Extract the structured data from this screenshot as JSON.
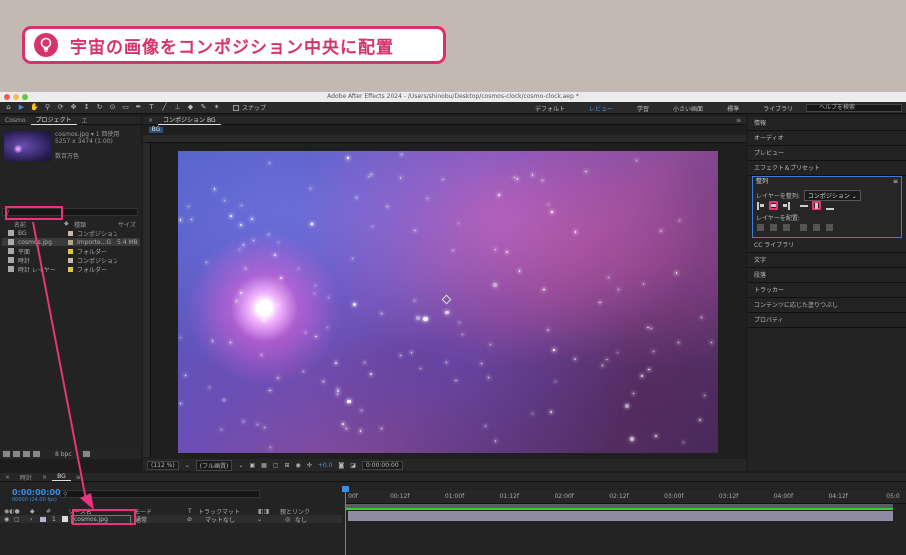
{
  "tip": {
    "title": "宇宙の画像をコンポジション中央に配置"
  },
  "window": {
    "title": "Adobe After Effects 2024 - /Users/shinobu/Desktop/cosmos-clock/cosmo-clock.aep *"
  },
  "toolbar": {
    "snap_label": "スナップ",
    "workspaces": [
      "デフォルト",
      "レビュー",
      "学習",
      "小さい画面",
      "標準",
      "ライブラリ"
    ],
    "active_workspace": "レビュー",
    "help_placeholder": "ヘルプを検索"
  },
  "project": {
    "tabs": [
      "Cosmo",
      "プロジェクト",
      "エ"
    ],
    "meta": [
      "cosmos.jpg ▾ 1 回使用",
      "5257 x 3474 (1.00)",
      "数百万色"
    ],
    "headers": [
      "名前",
      "種類",
      "サイズ"
    ],
    "items": [
      {
        "name": "BG",
        "type": "コンポジション",
        "size": "",
        "color": "#c9bca6"
      },
      {
        "name": "cosmos.jpg",
        "type": "Importe...G",
        "size": "5.4 MB",
        "color": "#b4a58c"
      },
      {
        "name": "平面",
        "type": "フォルダー",
        "size": "",
        "color": "#e0c74a"
      },
      {
        "name": "時計",
        "type": "コンポジション",
        "size": "",
        "color": "#c9bca6"
      },
      {
        "name": "時計 レイヤー",
        "type": "フォルダー",
        "size": "",
        "color": "#e0c74a"
      }
    ],
    "footer_bpc": "8 bpc"
  },
  "comp": {
    "tab": "コンポジション BG",
    "subtab": "BG",
    "zoom": "(112 %)",
    "quality": "(フル画質)",
    "exposure": "+0.0",
    "timecode": "0:00:00:00"
  },
  "right": {
    "panels_top": [
      "情報",
      "オーディオ",
      "プレビュー",
      "エフェクト＆プリセット"
    ],
    "align_title": "整列",
    "align_to_label": "レイヤーを整列:",
    "align_to_value": "コンポジション",
    "distribute_label": "レイヤーを配置:",
    "panels_bottom": [
      "CC ライブラリ",
      "文字",
      "段落",
      "トラッカー",
      "コンテンツに応じた塗りつぶし",
      "プロパティ"
    ]
  },
  "timeline": {
    "tabs": [
      "時計",
      "BG"
    ],
    "time": "0:00:00:00",
    "fps": "00000 (24.00 fps)",
    "headers": [
      "#",
      "ソース名",
      "モード",
      "T",
      "トラックマット",
      "親とリンク"
    ],
    "layer": {
      "index": "1",
      "name": "cosmos.jpg",
      "mode": "通常",
      "matte": "マットなし",
      "parent": "なし"
    },
    "ticks": [
      "00f",
      "00:12f",
      "01:00f",
      "01:12f",
      "02:00f",
      "02:12f",
      "03:00f",
      "03:12f",
      "04:00f",
      "04:12f",
      "05:0"
    ]
  }
}
